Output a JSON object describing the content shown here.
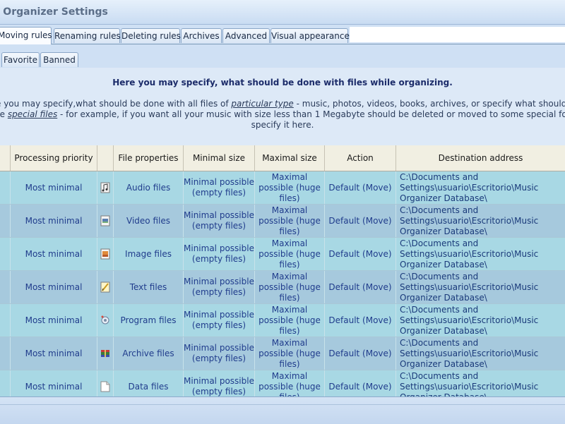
{
  "window": {
    "title": "sic Organizer Settings"
  },
  "tabs": [
    "Moving rules",
    "Renaming rules",
    "Deleting rules",
    "Archives",
    "Advanced",
    "Visual appearance"
  ],
  "subtabs": [
    "Favorite",
    "Banned"
  ],
  "header": {
    "title": "Here you may specify, what should be done with files while organizing.",
    "line1_a": "e you may specify,what should be done with all files of ",
    "line1_link": "particular type",
    "line1_b": " - music, photos, videos, books, archives, or specify what should be done w",
    "line2_a": "he ",
    "line2_link": "special files",
    "line2_b": " - for example, if you want all your music with size less than 1 Megabyte should be deleted or moved to some special folder - you ma",
    "line3": "specify it here."
  },
  "table": {
    "columns": [
      "Processing priority",
      "File properties",
      "Minimal size",
      "Maximal size",
      "Action",
      "Destination address"
    ],
    "rows": [
      {
        "priority": "Most minimal",
        "icon": "audio-file-icon",
        "properties": "Audio files",
        "min": "Minimal possible (empty files)",
        "max": "Maximal possible (huge files)",
        "action": "Default (Move)",
        "dest": "C:\\Documents and Settings\\usuario\\Escritorio\\Music Organizer Database\\"
      },
      {
        "priority": "Most minimal",
        "icon": "video-file-icon",
        "properties": "Video files",
        "min": "Minimal possible (empty files)",
        "max": "Maximal possible (huge files)",
        "action": "Default (Move)",
        "dest": "C:\\Documents and Settings\\usuario\\Escritorio\\Music Organizer Database\\"
      },
      {
        "priority": "Most minimal",
        "icon": "image-file-icon",
        "properties": "Image files",
        "min": "Minimal possible (empty files)",
        "max": "Maximal possible (huge files)",
        "action": "Default (Move)",
        "dest": "C:\\Documents and Settings\\usuario\\Escritorio\\Music Organizer Database\\"
      },
      {
        "priority": "Most minimal",
        "icon": "text-file-icon",
        "properties": "Text files",
        "min": "Minimal possible (empty files)",
        "max": "Maximal possible (huge files)",
        "action": "Default (Move)",
        "dest": "C:\\Documents and Settings\\usuario\\Escritorio\\Music Organizer Database\\"
      },
      {
        "priority": "Most minimal",
        "icon": "program-file-icon",
        "properties": "Program files",
        "min": "Minimal possible (empty files)",
        "max": "Maximal possible (huge files)",
        "action": "Default (Move)",
        "dest": "C:\\Documents and Settings\\usuario\\Escritorio\\Music Organizer Database\\"
      },
      {
        "priority": "Most minimal",
        "icon": "archive-file-icon",
        "properties": "Archive files",
        "min": "Minimal possible (empty files)",
        "max": "Maximal possible (huge files)",
        "action": "Default (Move)",
        "dest": "C:\\Documents and Settings\\usuario\\Escritorio\\Music Organizer Database\\"
      },
      {
        "priority": "Most minimal",
        "icon": "data-file-icon",
        "properties": "Data files",
        "min": "Minimal possible (empty files)",
        "max": "Maximal possible (huge files)",
        "action": "Default (Move)",
        "dest": "C:\\Documents and Settings\\usuario\\Escritorio\\Music Organizer Database\\"
      }
    ]
  }
}
